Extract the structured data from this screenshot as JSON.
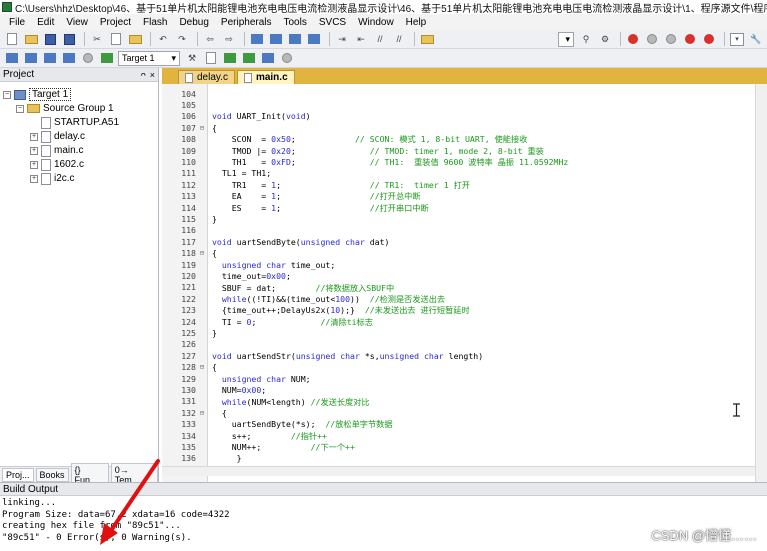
{
  "window": {
    "title": "C:\\Users\\hhz\\Desktop\\46、基于51单片机太阳能锂电池充电电压电流检测液晶显示设计\\46、基于51单片机太阳能锂电池充电电压电流检测液晶显示设计\\1、程序源文件\\程序\\89c51.uvproj - µVision"
  },
  "menu": [
    "File",
    "Edit",
    "View",
    "Project",
    "Flash",
    "Debug",
    "Peripherals",
    "Tools",
    "SVCS",
    "Window",
    "Help"
  ],
  "toolbar": {
    "target_select": "Target 1",
    "dropdown_arrow": "▾"
  },
  "project": {
    "header": "Project",
    "pin_icon": "ᴖ",
    "close_icon": "×",
    "tree": {
      "target": "Target 1",
      "group": "Source Group 1",
      "files": [
        "STARTUP.A51",
        "delay.c",
        "main.c",
        "1602.c",
        "i2c.c"
      ]
    },
    "tabs": [
      "Proj...",
      "Books",
      "{} Fun...",
      "0→ Tem..."
    ]
  },
  "editor": {
    "tabs": [
      "delay.c",
      "main.c"
    ],
    "active_tab": "main.c",
    "lines": [
      {
        "n": "104",
        "fold": "",
        "code": ""
      },
      {
        "n": "105",
        "fold": "",
        "code": ""
      },
      {
        "n": "106",
        "fold": "",
        "code": "void UART_Init(void)"
      },
      {
        "n": "107",
        "fold": "⊟",
        "code": "{"
      },
      {
        "n": "108",
        "fold": "",
        "code": "    SCON  = 0x50;            // SCON: 模式 1, 8-bit UART, 使能接收"
      },
      {
        "n": "109",
        "fold": "",
        "code": "    TMOD |= 0x20;               // TMOD: timer 1, mode 2, 8-bit 重装"
      },
      {
        "n": "110",
        "fold": "",
        "code": "    TH1   = 0xFD;               // TH1:  重装值 9600 波特率 晶振 11.0592MHz"
      },
      {
        "n": "111",
        "fold": "",
        "code": "  TL1 = TH1;"
      },
      {
        "n": "112",
        "fold": "",
        "code": "    TR1   = 1;                  // TR1:  timer 1 打开"
      },
      {
        "n": "113",
        "fold": "",
        "code": "    EA    = 1;                  //打开总中断"
      },
      {
        "n": "114",
        "fold": "",
        "code": "    ES    = 1;                  //打开串口中断"
      },
      {
        "n": "115",
        "fold": "",
        "code": "}"
      },
      {
        "n": "116",
        "fold": "",
        "code": ""
      },
      {
        "n": "117",
        "fold": "",
        "code": "void uartSendByte(unsigned char dat)"
      },
      {
        "n": "118",
        "fold": "⊟",
        "code": "{"
      },
      {
        "n": "119",
        "fold": "",
        "code": "  unsigned char time_out;"
      },
      {
        "n": "120",
        "fold": "",
        "code": "  time_out=0x00;"
      },
      {
        "n": "121",
        "fold": "",
        "code": "  SBUF = dat;        //将数据放入SBUF中"
      },
      {
        "n": "122",
        "fold": "",
        "code": "  while((!TI)&&(time_out<100))  //检测是否发送出去"
      },
      {
        "n": "123",
        "fold": "",
        "code": "  {time_out++;DelayUs2x(10);}  //未发送出去 进行短暂延时"
      },
      {
        "n": "124",
        "fold": "",
        "code": "  TI = 0;             //清除ti标志"
      },
      {
        "n": "125",
        "fold": "",
        "code": "}"
      },
      {
        "n": "126",
        "fold": "",
        "code": ""
      },
      {
        "n": "127",
        "fold": "",
        "code": "void uartSendStr(unsigned char *s,unsigned char length)"
      },
      {
        "n": "128",
        "fold": "⊟",
        "code": "{"
      },
      {
        "n": "129",
        "fold": "",
        "code": "  unsigned char NUM;"
      },
      {
        "n": "130",
        "fold": "",
        "code": "  NUM=0x00;"
      },
      {
        "n": "131",
        "fold": "",
        "code": "  while(NUM<length) //发送长度对比"
      },
      {
        "n": "132",
        "fold": "⊟",
        "code": "  {"
      },
      {
        "n": "133",
        "fold": "",
        "code": "    uartSendByte(*s);  //放松单字节数据"
      },
      {
        "n": "134",
        "fold": "",
        "code": "    s++;        //指针++"
      },
      {
        "n": "135",
        "fold": "",
        "code": "    NUM++;          //下一个++"
      },
      {
        "n": "136",
        "fold": "",
        "code": "     }"
      }
    ]
  },
  "build": {
    "header": "Build Output",
    "lines": [
      "linking...",
      "Program Size: data=67.2 xdata=16 code=4322",
      "creating hex file from \"89c51\"...",
      "\"89c51\" - 0 Error(s), 0 Warning(s)."
    ]
  },
  "watermark": "CSDN @懵懂……",
  "colors": {
    "keyword": "#2a2ad6",
    "comment": "#1b9a1b",
    "tab_bar": "#e1b43f",
    "arrow": "#e01010"
  }
}
